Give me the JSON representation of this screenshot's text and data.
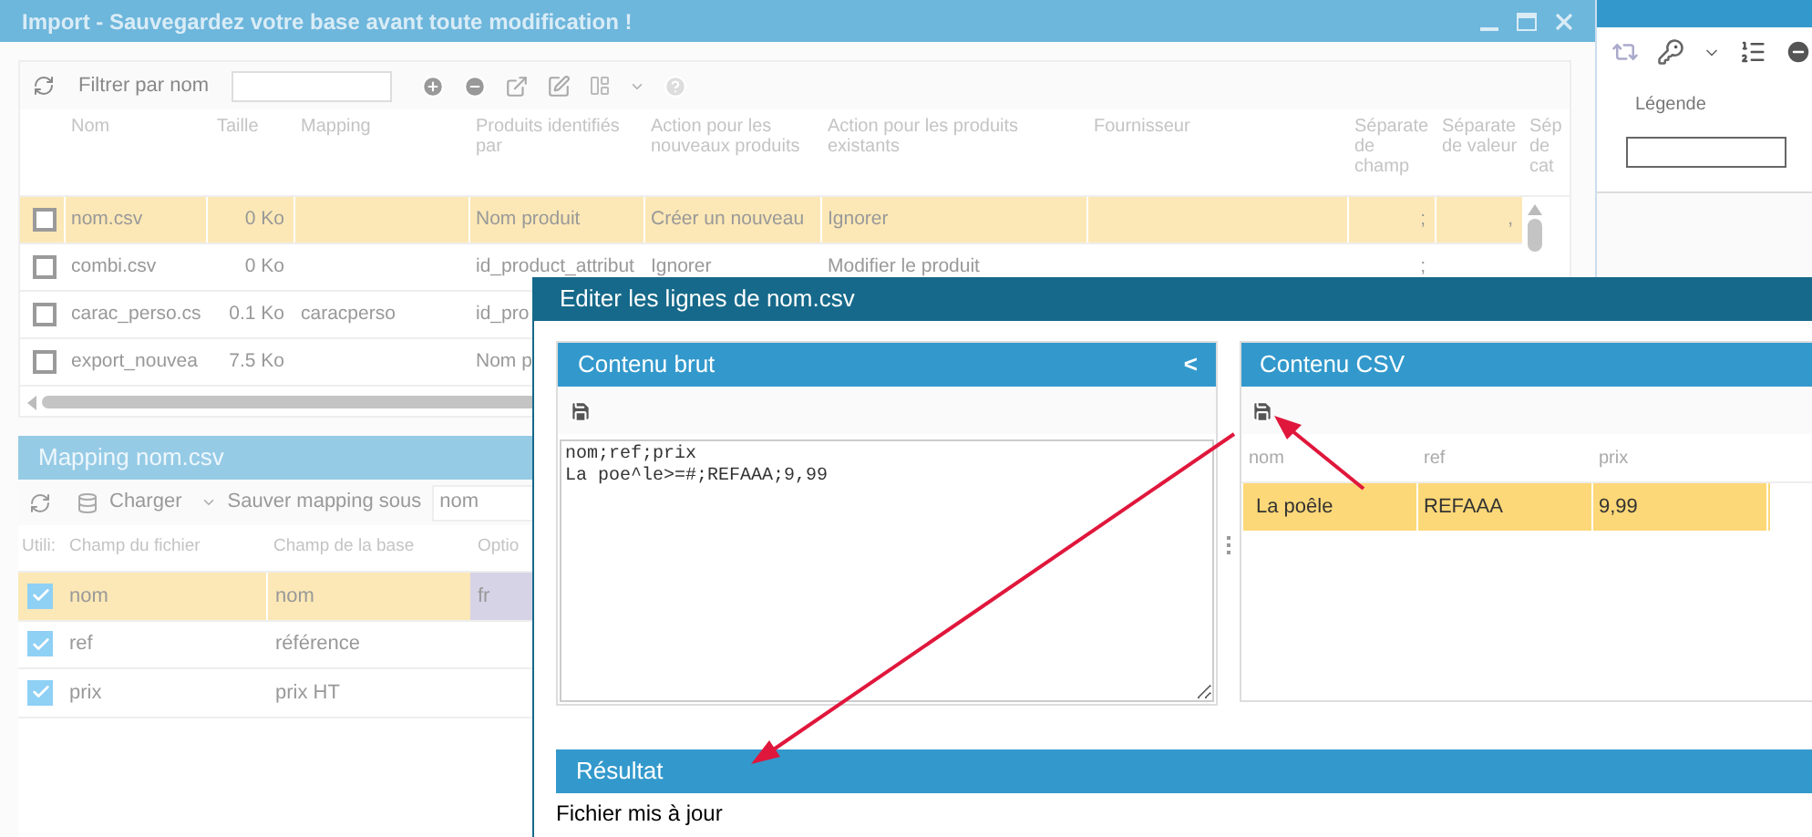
{
  "import_window": {
    "title": "Import - Sauvegardez votre base avant toute modification !",
    "toolbar": {
      "filter_label": "Filtrer par nom"
    },
    "table": {
      "columns": [
        "Nom",
        "Taille",
        "Mapping",
        "Produits identifiés par",
        "Action pour les nouveaux produits",
        "Action pour les produits existants",
        "Fournisseur",
        "Séparate de champ",
        "Séparate de valeur",
        "Sép de cat"
      ],
      "rows": [
        {
          "selected": true,
          "checked": false,
          "cells": [
            "nom.csv",
            "0 Ko",
            "",
            "Nom produit",
            "Créer un nouveau",
            "Ignorer",
            "",
            ";",
            ","
          ]
        },
        {
          "selected": false,
          "checked": false,
          "cells": [
            "combi.csv",
            "0 Ko",
            "",
            "id_product_attribut",
            "Ignorer",
            "Modifier le produit",
            "",
            ";",
            ""
          ]
        },
        {
          "selected": false,
          "checked": false,
          "cells": [
            "carac_perso.cs",
            "0.1 Ko",
            "caracperso",
            "id_pro",
            "",
            "",
            "",
            "",
            ""
          ]
        },
        {
          "selected": false,
          "checked": false,
          "cells": [
            "export_nouvea",
            "7.5 Ko",
            "",
            "Nom p",
            "",
            "",
            "",
            "",
            ""
          ]
        }
      ]
    }
  },
  "mapping_panel": {
    "title": "Mapping nom.csv",
    "load_button": "Charger",
    "save_as_label": "Sauver mapping sous",
    "save_as_value": "nom",
    "columns": [
      "Utili:",
      "Champ du fichier",
      "Champ de la base",
      "Optio"
    ],
    "rows": [
      {
        "selected": true,
        "checked": true,
        "file_field": "nom",
        "base_field": "nom",
        "option": "fr"
      },
      {
        "selected": false,
        "checked": true,
        "file_field": "ref",
        "base_field": "référence",
        "option": ""
      },
      {
        "selected": false,
        "checked": true,
        "file_field": "prix",
        "base_field": "prix HT",
        "option": ""
      }
    ]
  },
  "side_panel": {
    "legend_label": "Légende"
  },
  "dialog": {
    "title": "Editer les lignes de nom.csv",
    "raw_panel": {
      "title": "Contenu brut",
      "collapse": "<",
      "content": "nom;ref;prix\nLa poe^le>=#;REFAAA;9,99"
    },
    "csv_panel": {
      "title": "Contenu CSV",
      "columns": [
        "nom",
        "ref",
        "prix"
      ],
      "rows": [
        {
          "selected": true,
          "cells": [
            "La poêle",
            "REFAAA",
            "9,99"
          ]
        }
      ]
    },
    "result_panel": {
      "title": "Résultat",
      "message": "Fichier mis à jour"
    }
  }
}
